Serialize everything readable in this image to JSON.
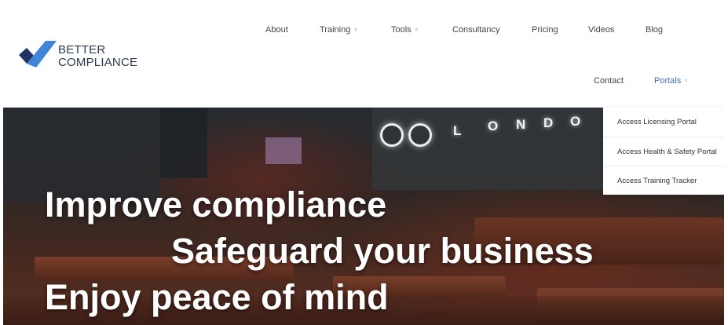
{
  "brand": {
    "line1": "BETTER",
    "line2": "COMPLIANCE",
    "colors": {
      "dark": "#1f3263",
      "light": "#3f86d8"
    }
  },
  "nav": {
    "about": "About",
    "training": "Training",
    "tools": "Tools",
    "consultancy": "Consultancy",
    "pricing": "Pricing",
    "videos": "Videos",
    "blog": "Blog",
    "contact": "Contact",
    "portals": "Portals",
    "caret": "▫",
    "active_color": "#3f6fc0"
  },
  "portals_menu": [
    "Access Licensing Portal",
    "Access Health & Safety Portal",
    "Access Training Tracker"
  ],
  "hero": {
    "sign": {
      "letters": [
        "L",
        "O",
        "N",
        "D",
        "O"
      ]
    },
    "line1": "Improve compliance",
    "line2": "Safeguard your business",
    "line3": "Enjoy peace of mind"
  }
}
